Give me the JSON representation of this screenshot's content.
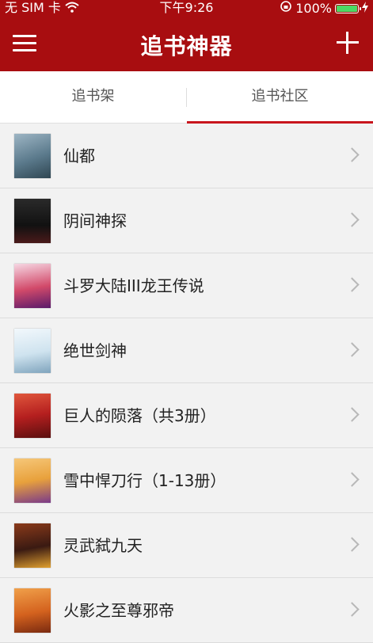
{
  "status_bar": {
    "carrier": "无 SIM 卡",
    "time": "下午9:26",
    "battery": "100%"
  },
  "header": {
    "title": "追书神器"
  },
  "tabs": [
    {
      "label": "追书架"
    },
    {
      "label": "追书社区"
    }
  ],
  "books": [
    {
      "title": "仙都",
      "cover_color": "#5b7a8c"
    },
    {
      "title": "阴间神探",
      "cover_color": "#1a1a1a"
    },
    {
      "title": "斗罗大陆III龙王传说",
      "cover_color": "#d24a6a"
    },
    {
      "title": "绝世剑神",
      "cover_color": "#cfe3ef"
    },
    {
      "title": "巨人的陨落（共3册）",
      "cover_color": "#b51f1f"
    },
    {
      "title": "雪中悍刀行（1-13册）",
      "cover_color": "#e8a13c"
    },
    {
      "title": "灵武弑九天",
      "cover_color": "#3a1a12"
    },
    {
      "title": "火影之至尊邪帝",
      "cover_color": "#d4621e"
    }
  ],
  "colors": {
    "brand_red": "#a80d10",
    "tab_indicator": "#c8161d"
  }
}
